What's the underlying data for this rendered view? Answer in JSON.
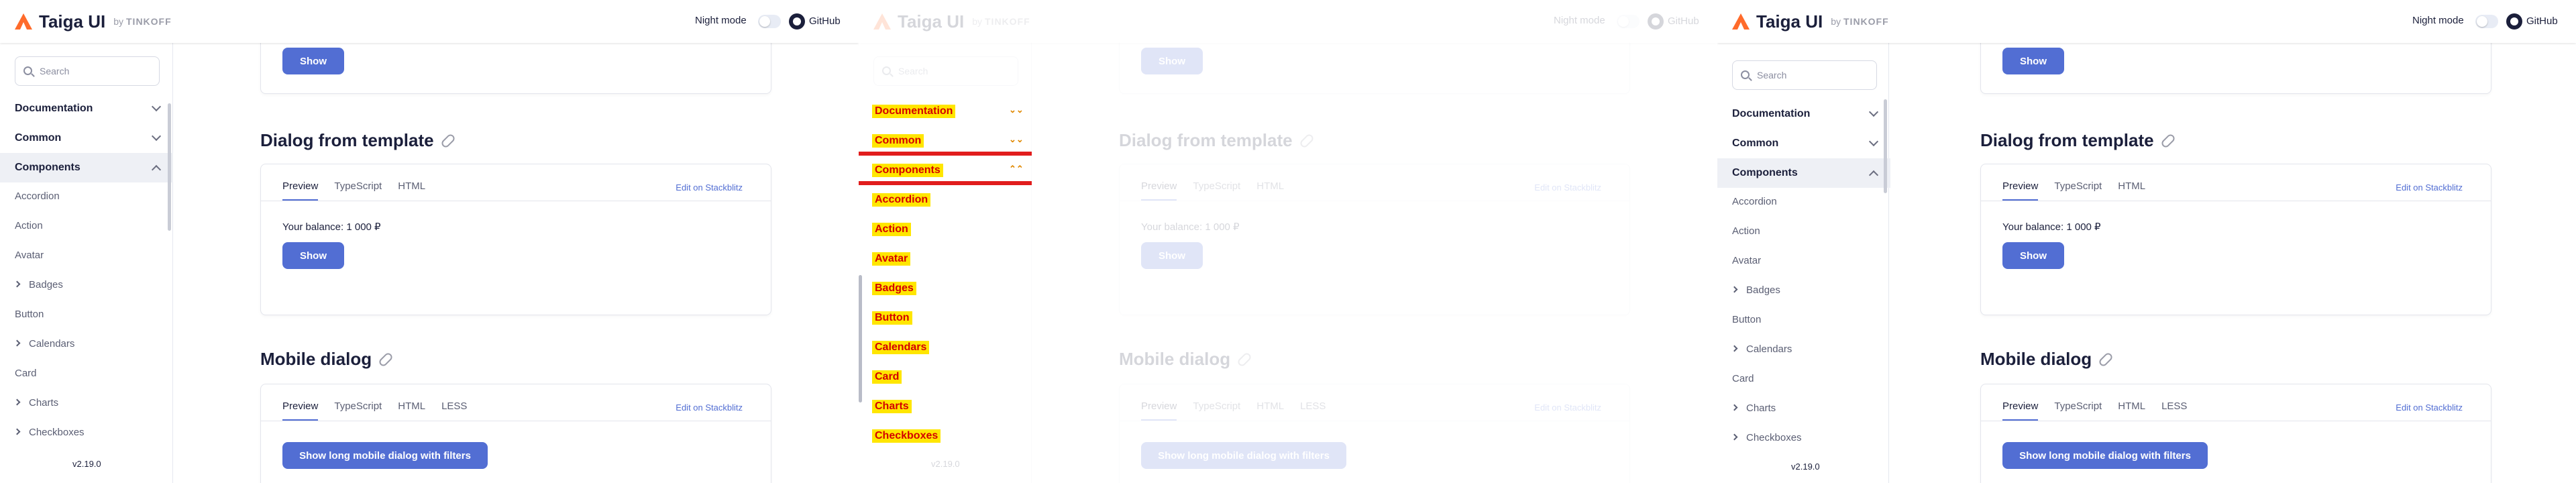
{
  "header": {
    "brand": "Taiga UI",
    "by": "by",
    "company": "TINKOFF",
    "night_mode": "Night mode",
    "github": "GitHub"
  },
  "sidebar": {
    "search_placeholder": "Search",
    "sections": [
      {
        "label": "Documentation",
        "expanded": false
      },
      {
        "label": "Common",
        "expanded": false
      },
      {
        "label": "Components",
        "expanded": true
      }
    ],
    "items": [
      {
        "label": "Accordion",
        "expandable": false
      },
      {
        "label": "Action",
        "expandable": false
      },
      {
        "label": "Avatar",
        "expandable": false
      },
      {
        "label": "Badges",
        "expandable": true
      },
      {
        "label": "Button",
        "expandable": false
      },
      {
        "label": "Calendars",
        "expandable": true
      },
      {
        "label": "Card",
        "expandable": false
      },
      {
        "label": "Charts",
        "expandable": true
      },
      {
        "label": "Checkboxes",
        "expandable": true
      }
    ],
    "version": "v2.19.0"
  },
  "content": {
    "show_label": "Show",
    "dialog_title": "Dialog from template",
    "mobile_title": "Mobile dialog",
    "tabs_main": [
      "Preview",
      "TypeScript",
      "HTML"
    ],
    "tabs_mobile": [
      "Preview",
      "TypeScript",
      "HTML",
      "LESS"
    ],
    "stackblitz": "Edit on Stackblitz",
    "balance": "Your balance: 1 000 ₽",
    "mobile_button": "Show long mobile dialog with filters"
  },
  "colors": {
    "accent": "#526ed3",
    "brand": "#ff6b2b",
    "highlight": "#ffe600",
    "marker": "#e11d1d"
  }
}
